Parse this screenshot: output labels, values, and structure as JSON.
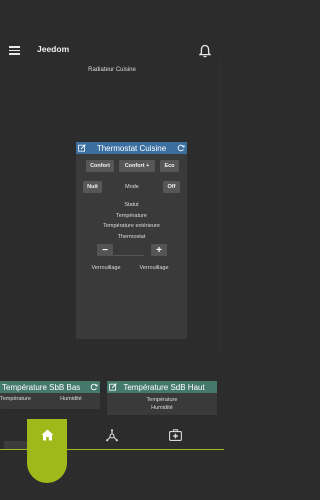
{
  "app": {
    "title": "Jeedom"
  },
  "page": {
    "label": "Radiateur Cuisine"
  },
  "thermostat": {
    "title": "Thermostat Cuisine",
    "mode_buttons": [
      "Confort",
      "Confort +",
      "Eco"
    ],
    "nuit_label": "Nuit",
    "mode_label": "Mode",
    "off_label": "Off",
    "statut_label": "Statut",
    "temperature_label": "Température",
    "temperature_ext_label": "Température extérieure",
    "thermostat_label": "Thermostat",
    "minus_label": "−",
    "plus_label": "+",
    "lock_labels": [
      "Verrouillage",
      "Verrouillage"
    ]
  },
  "widget_sdb_bas": {
    "title": "Température SbB Bas",
    "temperature_label": "Température",
    "humidity_label": "Humidité"
  },
  "widget_sdb_haut": {
    "title": "Température SdB Haut",
    "temperature_label": "Température",
    "humidity_label": "Humidité"
  },
  "nav": {
    "active_tab": "home",
    "accent": "#9fb91a"
  },
  "icons": [
    "menu-icon",
    "bell-icon",
    "edit-icon",
    "refresh-icon",
    "home-icon",
    "hub-icon",
    "medkit-icon"
  ]
}
